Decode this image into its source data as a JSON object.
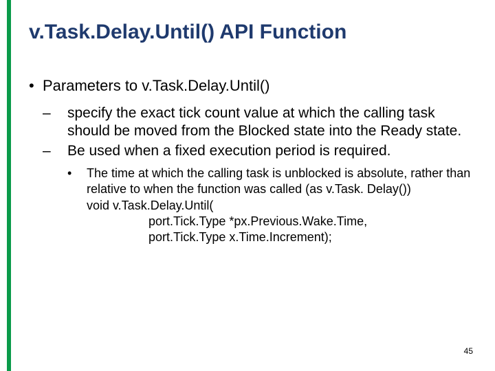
{
  "title": "v.Task.Delay.Until() API Function",
  "lvl1": "Parameters to v.Task.Delay.Until()",
  "lvl2a": "specify the exact tick count value at which the calling task should be moved from the Blocked state into the Ready state.",
  "lvl2b": "Be used when a fixed execution period is required.",
  "lvl3a": "The time at which the calling task is unblocked is absolute, rather than relative to when the function was called (as v.Task. Delay())",
  "code1": "void v.Task.Delay.Until(",
  "code2": "port.Tick.Type *px.Previous.Wake.Time,",
  "code3": "port.Tick.Type x.Time.Increment);",
  "page": "45"
}
